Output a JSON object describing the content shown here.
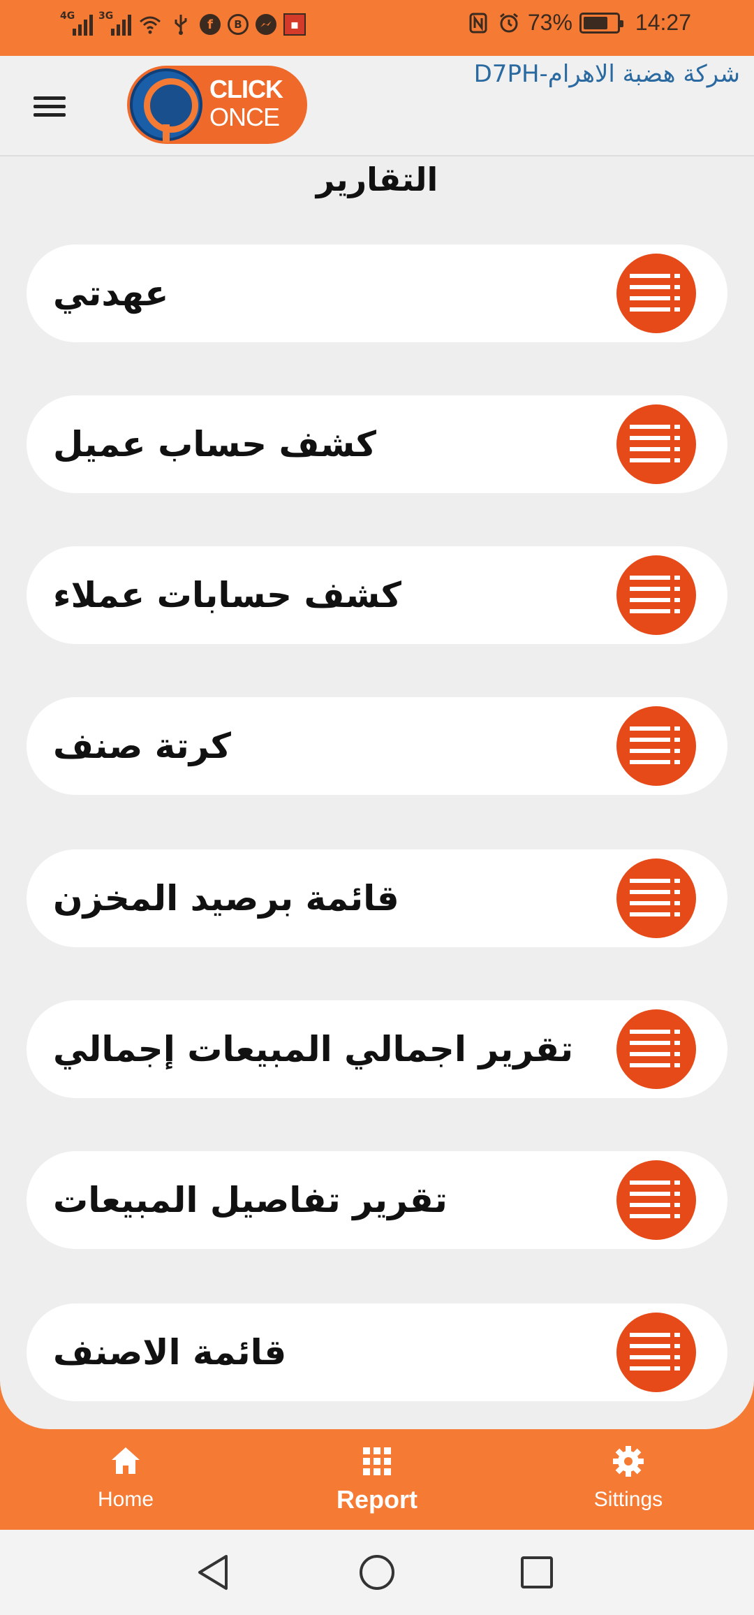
{
  "status_bar": {
    "network1": "4G",
    "network2": "3G",
    "battery_percent": "73%",
    "battery_level": 0.73,
    "time": "14:27"
  },
  "header": {
    "logo_line1": "CLICK",
    "logo_line2": "ONCE",
    "company": "D7PH-شركة هضبة الاهرام"
  },
  "page": {
    "title": "التقارير"
  },
  "reports": [
    {
      "label": "عهدتي"
    },
    {
      "label": "كشف حساب عميل"
    },
    {
      "label": "كشف حسابات عملاء"
    },
    {
      "label": "كرتة صنف"
    },
    {
      "label": "قائمة برصيد المخزن"
    },
    {
      "label": "تقرير اجمالي المبيعات إجمالي"
    },
    {
      "label": "تقرير تفاصيل المبيعات"
    },
    {
      "label": "قائمة الاصنف"
    }
  ],
  "bottom_nav": {
    "home": "Home",
    "report": "Report",
    "settings": "Sittings",
    "active": "report"
  },
  "colors": {
    "accent": "#f57b35",
    "icon_circle": "#e64a19",
    "content_bg": "#eeeeee",
    "company_text": "#2a6aa0"
  }
}
